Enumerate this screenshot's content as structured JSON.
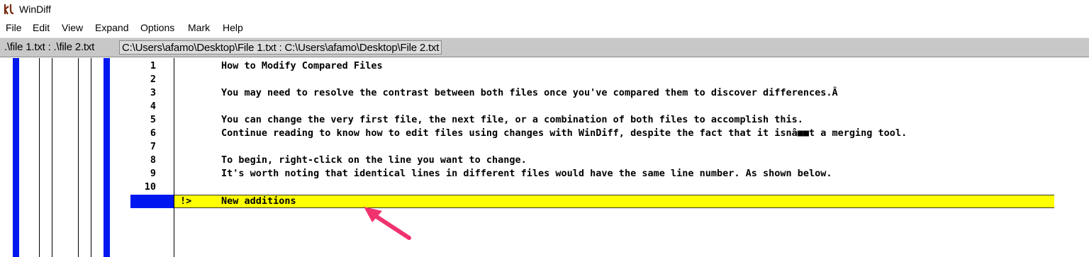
{
  "window": {
    "title": "WinDiff"
  },
  "menu": [
    "File",
    "Edit",
    "View",
    "Expand",
    "Options",
    "Mark",
    "Help"
  ],
  "pathbar": {
    "names": ".\\file 1.txt : .\\file 2.txt",
    "full": "C:\\Users\\afamo\\Desktop\\File 1.txt : C:\\Users\\afamo\\Desktop\\File 2.txt"
  },
  "lines": [
    {
      "num": "1",
      "text": "How to Modify Compared Files"
    },
    {
      "num": "2",
      "text": ""
    },
    {
      "num": "3",
      "text": "You may need to resolve the contrast between both files once you've compared them to discover differences.Â"
    },
    {
      "num": "4",
      "text": ""
    },
    {
      "num": "5",
      "text": "You can change the very first file, the next file, or a combination of both files to accomplish this."
    },
    {
      "num": "6",
      "text": "Continue reading to know how to edit files using changes with WinDiff, despite the fact that it isnâ■■t a merging tool."
    },
    {
      "num": "7",
      "text": ""
    },
    {
      "num": "8",
      "text": "To begin, right-click on the line you want to change."
    },
    {
      "num": "9",
      "text": "It's worth noting that identical lines in different files would have the same line number. As shown below."
    },
    {
      "num": "10",
      "text": ""
    }
  ],
  "changed_line": {
    "marker": "!>",
    "text": "New additions"
  },
  "colors": {
    "outline_blue": "#0018f0",
    "changed_yellow": "#ffff00",
    "arrow": "#f0326e"
  },
  "icons": {
    "app": "windiff-app-icon",
    "annotation": "arrow-annotation-icon"
  }
}
